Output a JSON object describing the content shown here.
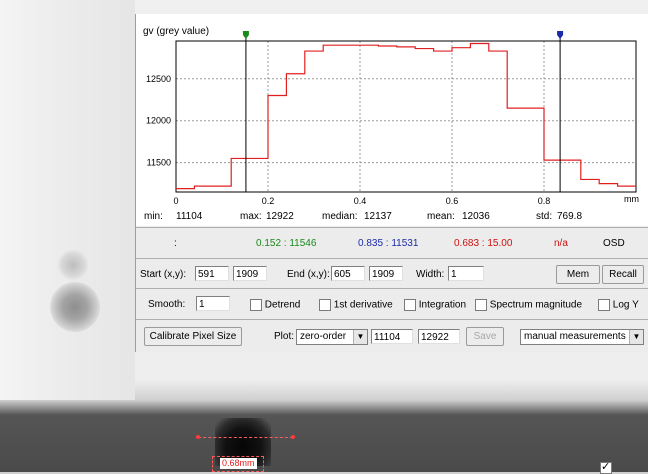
{
  "plot": {
    "title": "gv (grey value)",
    "x_unit": "mm",
    "y_ticks": [
      "12500",
      "12000",
      "11500"
    ],
    "x_ticks": [
      "0",
      "0.2",
      "0.4",
      "0.6",
      "0.8"
    ],
    "marker_green": "#1a8a1a",
    "marker_blue": "#1a2aa8",
    "line_color": "#e02020"
  },
  "chart_data": {
    "type": "line",
    "xlabel": "mm",
    "ylabel": "gv (grey value)",
    "xlim": [
      0,
      1.0
    ],
    "ylim": [
      11150,
      12950
    ],
    "grid": true,
    "series": [
      {
        "x": [
          0.0,
          0.04,
          0.08,
          0.12,
          0.16,
          0.2,
          0.24,
          0.28,
          0.32,
          0.36,
          0.4,
          0.44,
          0.48,
          0.52,
          0.56,
          0.6,
          0.64,
          0.68,
          0.72,
          0.76,
          0.8,
          0.84,
          0.88,
          0.92,
          0.96,
          1.0
        ],
        "y": [
          11190,
          11220,
          11220,
          11550,
          11550,
          12300,
          12560,
          12830,
          12900,
          12900,
          12900,
          12890,
          12880,
          12860,
          12830,
          12870,
          12920,
          12830,
          12150,
          12150,
          11530,
          11530,
          11300,
          11250,
          11220,
          11220
        ]
      }
    ],
    "cursors": [
      {
        "x": 0.152,
        "color": "#1a8a1a"
      },
      {
        "x": 0.835,
        "color": "#1a2aa8"
      }
    ]
  },
  "stats": {
    "min_label": "min:",
    "min": "11104",
    "max_label": "max:",
    "max": "12922",
    "median_label": "median:",
    "median": "12137",
    "mean_label": "mean:",
    "mean": "12036",
    "std_label": "std:",
    "std": "769.8"
  },
  "cursor_row": {
    "colon": ":",
    "green": "0.152 : 11546",
    "blue": "0.835 : 11531",
    "red": "0.683 : 15.00",
    "na": "n/a",
    "osd_label": "OSD",
    "osd_checked": true
  },
  "start": {
    "label": "Start (x,y):",
    "x": "591",
    "y": "1909"
  },
  "end": {
    "label": "End (x,y):",
    "x": "605",
    "y": "1909"
  },
  "width": {
    "label": "Width:",
    "value": "1"
  },
  "buttons": {
    "mem": "Mem",
    "recall": "Recall",
    "calibrate": "Calibrate Pixel Size",
    "save": "Save"
  },
  "smooth": {
    "label": "Smooth:",
    "value": "1"
  },
  "options": {
    "detrend": "Detrend",
    "first_derivative": "1st derivative",
    "integration": "Integration",
    "spectrum": "Spectrum magnitude",
    "logy": "Log Y"
  },
  "plot_ctrl": {
    "label": "Plot:",
    "mode": "zero-order",
    "min": "11104",
    "max": "12922",
    "measurements": "manual measurements"
  },
  "overlay": {
    "measurement": "0.68mm"
  }
}
